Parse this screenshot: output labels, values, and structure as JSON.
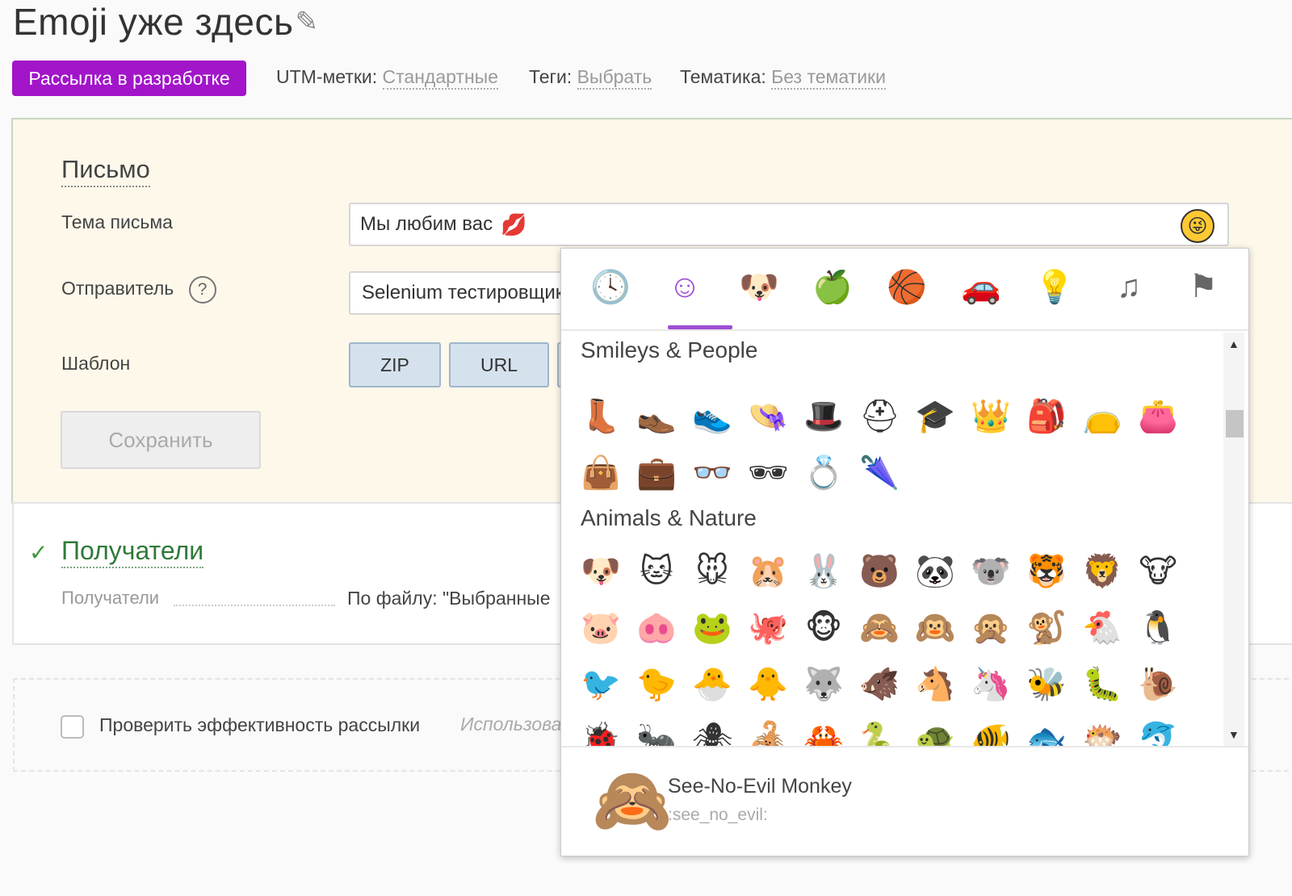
{
  "header": {
    "title": "Emoji уже здесь",
    "edit_icon": "pencil-icon",
    "status_badge": "Рассылка в разработке",
    "utm_label": "UTM-метки:",
    "utm_value": "Стандартные",
    "tags_label": "Теги:",
    "tags_value": "Выбрать",
    "topic_label": "Тематика:",
    "topic_value": "Без тематики"
  },
  "letter": {
    "section_title": "Письмо",
    "subject_label": "Тема письма",
    "subject_value": "Мы любим вас",
    "subject_emoji": "💋",
    "emoji_toggle": "😜",
    "sender_label": "Отправитель",
    "help_icon": "?",
    "sender_value": "Selenium тестировщик",
    "template_label": "Шаблон",
    "template_buttons": [
      "ZIP",
      "URL"
    ],
    "save_label": "Сохранить"
  },
  "recipients": {
    "check_icon": "✓",
    "title": "Получатели",
    "label": "Получатели",
    "value": "По файлу: \"Выбранные"
  },
  "effectiveness": {
    "label": "Проверить эффективность рассылки",
    "hint": "Использовать"
  },
  "emoji_picker": {
    "categories": [
      {
        "icon": "clock-icon",
        "glyph": "🕓"
      },
      {
        "icon": "smiley-icon",
        "glyph": "☺"
      },
      {
        "icon": "dog-icon",
        "glyph": "🐶"
      },
      {
        "icon": "apple-icon",
        "glyph": "🍏"
      },
      {
        "icon": "basketball-icon",
        "glyph": "🏀"
      },
      {
        "icon": "car-icon",
        "glyph": "🚗"
      },
      {
        "icon": "lightbulb-icon",
        "glyph": "💡"
      },
      {
        "icon": "symbols-icon",
        "glyph": "♫"
      },
      {
        "icon": "flags-icon",
        "glyph": "⚑"
      }
    ],
    "active_category": "smiley-icon",
    "sections": [
      {
        "name": "Smileys & People",
        "rows": [
          [
            "👢",
            "👞",
            "👟",
            "👒",
            "🎩",
            "⛑",
            "🎓",
            "👑",
            "🎒",
            "👝",
            "👛"
          ],
          [
            "👜",
            "💼",
            "👓",
            "🕶",
            "💍",
            "🌂"
          ]
        ]
      },
      {
        "name": "Animals & Nature",
        "rows": [
          [
            "🐶",
            "🐱",
            "🐭",
            "🐹",
            "🐰",
            "🐻",
            "🐼",
            "🐨",
            "🐯",
            "🦁",
            "🐮"
          ],
          [
            "🐷",
            "🐽",
            "🐸",
            "🐙",
            "🐵",
            "🙈",
            "🙉",
            "🙊",
            "🐒",
            "🐔",
            "🐧"
          ],
          [
            "🐦",
            "🐤",
            "🐣",
            "🐥",
            "🐺",
            "🐗",
            "🐴",
            "🦄",
            "🐝",
            "🐛",
            "🐌"
          ],
          [
            "🐞",
            "🐜",
            "🕷",
            "🦂",
            "🦀",
            "🐍",
            "🐢",
            "🐠",
            "🐟",
            "🐡",
            "🐬"
          ]
        ]
      }
    ],
    "preview": {
      "emoji": "🙈",
      "name": "See-No-Evil Monkey",
      "code": ":see_no_evil:"
    }
  }
}
